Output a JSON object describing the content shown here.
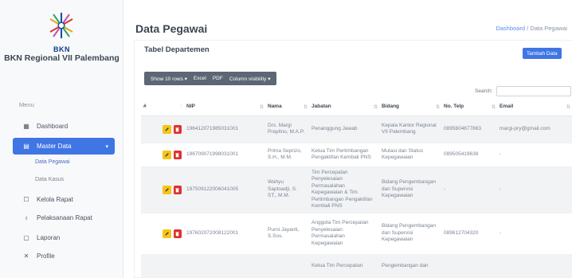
{
  "sidebar": {
    "brand_top": "BKN",
    "brand_name": "BKN Regional VII Palembang",
    "menu_title": "Menu",
    "items": [
      {
        "label": "Dashboard",
        "icon": "grid-icon"
      },
      {
        "label": "Master Data",
        "icon": "database-icon"
      },
      {
        "label": "Kelola Rapat",
        "icon": "calendar-icon"
      },
      {
        "label": "Pelaksanaan Rapat",
        "icon": "trophy-icon"
      },
      {
        "label": "Laporan",
        "icon": "report-icon"
      },
      {
        "label": "Profile",
        "icon": "user-icon"
      }
    ],
    "sub_items": [
      {
        "label": "Data Pegawai"
      },
      {
        "label": "Data Kasus"
      }
    ]
  },
  "header": {
    "title": "Data Pegawai",
    "breadcrumb_home": "Dashboard",
    "breadcrumb_sep": "/",
    "breadcrumb_current": "Data Pegawai"
  },
  "card": {
    "title": "Tabel Departemen",
    "add_button": "Tambah Data",
    "search_label": "Search:",
    "toolbar": {
      "show_rows": "Show 10 rows ▾",
      "excel": "Excel",
      "pdf": "PDF",
      "column_visibility": "Column visibility ▾"
    }
  },
  "table": {
    "headers": [
      "#",
      "NIP",
      "Nama",
      "Jabatan",
      "Bidang",
      "No. Telp",
      "Email"
    ],
    "rows": [
      {
        "nip": "196412071985031001",
        "nama": "Drs. Margi Prayitno, M.A.P.",
        "jabatan": "Penanggung Jawab",
        "bidang": "Kepala Kantor Regional VII Palembang",
        "telp": "0895604677863",
        "email": "margi-pry@gmail.com"
      },
      {
        "nip": "196709071998031001",
        "nama": "Prima Seprizo, S.H., M.M.",
        "jabatan": "Ketua Tim Pertimbangan Pengaktifan Kembali PNS",
        "bidang": "Mutasi dan Status Kepegawaian",
        "telp": "089505419638",
        "email": "-"
      },
      {
        "nip": "197509122006041005",
        "nama": "Wahyu Saptoadji, S. ST., M.M.",
        "jabatan": "Tim Percepatan Penyelesaian Permasalahan Kepegawaian & Tim Pertimbangan Pengaktifan Kembali PNS",
        "bidang": "Bidang Pengembangan dan Supervisi Kepegawaian",
        "telp": "-",
        "email": "-"
      },
      {
        "nip": "197602072008122001",
        "nama": "Purni Jayanti, S.Sos.",
        "jabatan": "Anggota Tim Percepatan Penyelesaian Permasalahan Kepegawaian",
        "bidang": "Bidang Pengembangan dan Supervisi Kepegawaian",
        "telp": "089612704320",
        "email": "-"
      },
      {
        "nip": "",
        "nama": "",
        "jabatan": "Ketua Tim Percepatan",
        "bidang": "Pengembangan dan",
        "telp": "",
        "email": ""
      }
    ]
  },
  "colors": {
    "accent": "#3f76e4",
    "edit": "#f5c518",
    "delete": "#e03131",
    "toolbar": "#5c6674"
  }
}
